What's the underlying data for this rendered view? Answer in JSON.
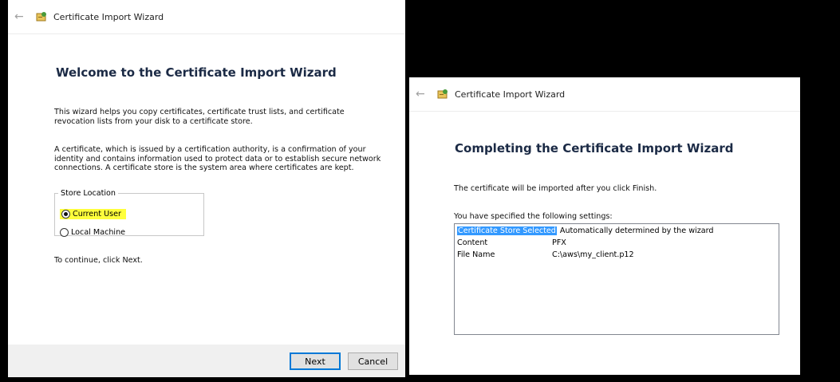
{
  "left_window": {
    "title": "Certificate Import Wizard",
    "heading": "Welcome to the Certificate Import Wizard",
    "para1": "This wizard helps you copy certificates, certificate trust lists, and certificate revocation lists from your disk to a certificate store.",
    "para2": "A certificate, which is issued by a certification authority, is a confirmation of your identity and contains information used to protect data or to establish secure network connections. A certificate store is the system area where certificates are kept.",
    "store_location": {
      "legend": "Store Location",
      "options": [
        {
          "label": "Current User",
          "checked": true,
          "highlighted": true
        },
        {
          "label": "Local Machine",
          "checked": false
        }
      ]
    },
    "continue_text": "To continue, click Next.",
    "buttons": {
      "next": "Next",
      "cancel": "Cancel"
    }
  },
  "right_window": {
    "title": "Certificate Import Wizard",
    "heading": "Completing the Certificate Import Wizard",
    "info": "The certificate will be imported after you click Finish.",
    "settings_label": "You have specified the following settings:",
    "settings": [
      {
        "key": "Certificate Store Selected",
        "value": "Automatically determined by the wizard",
        "selected": true
      },
      {
        "key": "Content",
        "value": "PFX"
      },
      {
        "key": "File Name",
        "value": "C:\\aws\\my_client.p12"
      }
    ]
  },
  "colors": {
    "highlight": "#ffff3c",
    "selection": "#3399ff",
    "heading": "#1b2a45"
  }
}
